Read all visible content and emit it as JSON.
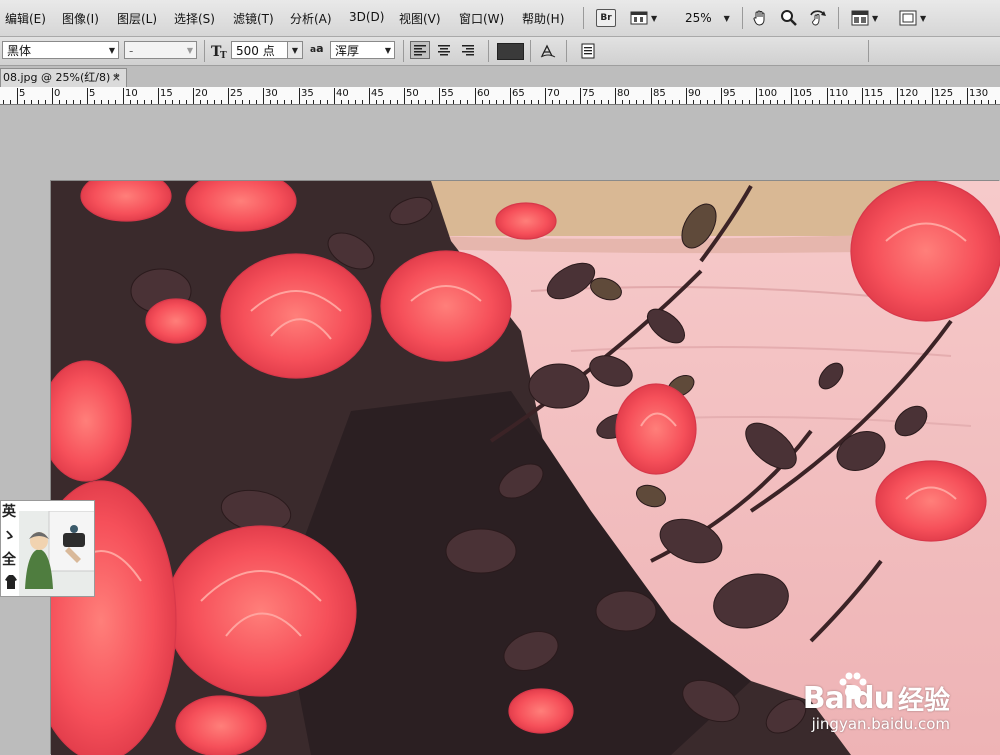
{
  "menu": {
    "items": [
      "编辑(E)",
      "图像(I)",
      "图层(L)",
      "选择(S)",
      "滤镜(T)",
      "分析(A)",
      "3D(D)",
      "视图(V)",
      "窗口(W)",
      "帮助(H)"
    ],
    "bridge_label": "Br",
    "zoom": "25%"
  },
  "options": {
    "font_family": "黑体",
    "font_style": "-",
    "font_size": "500 点",
    "antialias_symbol": "a",
    "antialias": "浑厚",
    "text_color": "#3a3a3a"
  },
  "document": {
    "tab_title": "08.jpg @ 25%(红/8) *",
    "close_glyph": "×"
  },
  "ruler": {
    "labels": [
      "5",
      "0",
      "5",
      "10",
      "15",
      "20",
      "25",
      "30",
      "35",
      "40",
      "45",
      "50",
      "55",
      "60",
      "65",
      "70",
      "75",
      "80",
      "85",
      "90",
      "95",
      "100",
      "105",
      "110",
      "115",
      "120",
      "125",
      "130"
    ]
  },
  "thumbnail": {
    "chars": [
      "英",
      "ゝ",
      "全"
    ]
  },
  "watermark": {
    "brand": "Baidu",
    "suffix": "经验",
    "url": "jingyan.baidu.com"
  }
}
